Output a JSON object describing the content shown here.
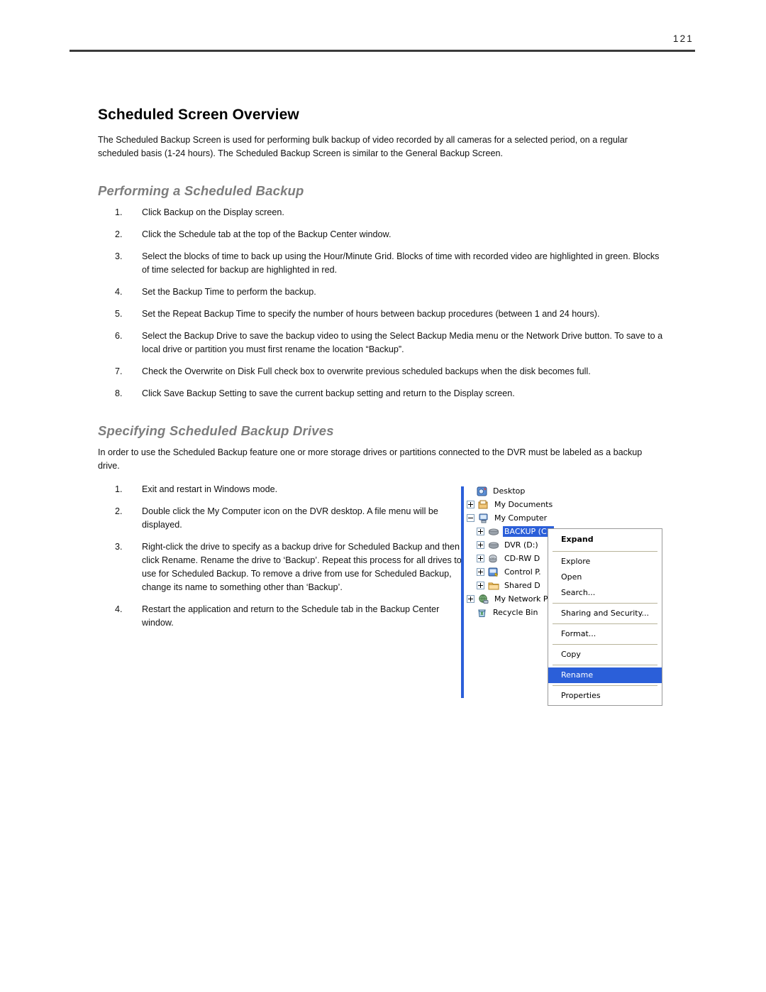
{
  "header": {
    "page_number": "121"
  },
  "main": {
    "section_title": "Scheduled Screen Overview",
    "intro": "The Scheduled Backup Screen is used for performing bulk backup of video recorded by all cameras for a selected period, on a regular scheduled basis (1-24 hours). The Scheduled Backup Screen is similar to the General Backup Screen.",
    "subsection_1": {
      "title": "Performing a Scheduled Backup",
      "steps": [
        {
          "num": "1.",
          "text": "Click Backup on the Display screen."
        },
        {
          "num": "2.",
          "text": "Click the Schedule tab at the top of the Backup Center window."
        },
        {
          "num": "3.",
          "text": "Select the blocks of time to back up using the Hour/Minute Grid. Blocks of time with recorded video are highlighted in green. Blocks of time selected for backup are highlighted in red."
        },
        {
          "num": "4.",
          "text": "Set the Backup Time to perform the backup."
        },
        {
          "num": "5.",
          "text": "Set the Repeat Backup Time to specify the number of hours between backup procedures (between 1 and 24 hours)."
        },
        {
          "num": "6.",
          "text": "Select the Backup Drive to save the backup video to using the Select Backup Media menu or the Network Drive button. To save to a local drive or partition you must first rename the location “Backup”."
        },
        {
          "num": "7.",
          "text": "Check the Overwrite on Disk Full check box to overwrite previous scheduled backups when the disk becomes full."
        },
        {
          "num": "8.",
          "text": "Click Save Backup Setting to save the current backup setting and return to the Display screen."
        }
      ]
    },
    "subsection_2": {
      "title": "Specifying Scheduled Backup Drives",
      "intro": "In order to use the Scheduled Backup feature one or more storage drives or partitions connected to the DVR must be labeled as a backup drive.",
      "steps": [
        {
          "num": "1.",
          "text": "Exit and restart in Windows mode."
        },
        {
          "num": "2.",
          "text": "Double click the My Computer icon on the DVR desktop. A file menu will be displayed."
        },
        {
          "num": "3.",
          "text": "Right-click the drive to specify as a backup drive for Scheduled Backup and then click Rename. Rename the drive to ‘Backup’. Repeat this process for all drives to use for Scheduled Backup. To remove a drive from use for Scheduled Backup, change its name to something other than ‘Backup’."
        },
        {
          "num": "4.",
          "text": "Restart the application and return to the Schedule tab in the Backup Center window."
        }
      ]
    }
  },
  "screenshot": {
    "tree": [
      {
        "label": "Desktop",
        "icon": "desktop-icon",
        "expander": "none",
        "indent": 0,
        "selected": false
      },
      {
        "label": "My Documents",
        "icon": "my-documents-icon",
        "expander": "plus",
        "indent": 0,
        "selected": false
      },
      {
        "label": "My Computer",
        "icon": "my-computer-icon",
        "expander": "minus",
        "indent": 0,
        "selected": false
      },
      {
        "label": "BACKUP (C:)",
        "icon": "hard-drive-icon",
        "expander": "plus",
        "indent": 1,
        "selected": true
      },
      {
        "label": "DVR (D:)",
        "icon": "hard-drive-icon",
        "expander": "plus",
        "indent": 1,
        "selected": false
      },
      {
        "label": "CD-RW D",
        "icon": "cd-drive-icon",
        "expander": "plus",
        "indent": 1,
        "selected": false
      },
      {
        "label": "Control P.",
        "icon": "control-panel-icon",
        "expander": "plus",
        "indent": 1,
        "selected": false
      },
      {
        "label": "Shared D",
        "icon": "folder-icon",
        "expander": "plus",
        "indent": 1,
        "selected": false
      },
      {
        "label": "My Network P",
        "icon": "network-icon",
        "expander": "plus",
        "indent": 0,
        "selected": false
      },
      {
        "label": "Recycle Bin",
        "icon": "recycle-bin-icon",
        "expander": "none",
        "indent": 0,
        "selected": false
      }
    ],
    "context_menu": [
      {
        "type": "item",
        "label": "Expand",
        "bold": true,
        "highlight": false
      },
      {
        "type": "sep"
      },
      {
        "type": "item",
        "label": "Explore",
        "bold": false,
        "highlight": false
      },
      {
        "type": "item",
        "label": "Open",
        "bold": false,
        "highlight": false
      },
      {
        "type": "item",
        "label": "Search...",
        "bold": false,
        "highlight": false
      },
      {
        "type": "sep"
      },
      {
        "type": "item",
        "label": "Sharing and Security...",
        "bold": false,
        "highlight": false
      },
      {
        "type": "sep"
      },
      {
        "type": "item",
        "label": "Format...",
        "bold": false,
        "highlight": false
      },
      {
        "type": "sep"
      },
      {
        "type": "item",
        "label": "Copy",
        "bold": false,
        "highlight": false
      },
      {
        "type": "sep"
      },
      {
        "type": "item",
        "label": "Rename",
        "bold": false,
        "highlight": true
      },
      {
        "type": "sep"
      },
      {
        "type": "item",
        "label": "Properties",
        "bold": false,
        "highlight": false
      }
    ],
    "colors": {
      "selection_blue": "#2b5fd9",
      "panel_border_blue": "#2b5fd9",
      "menu_border": "#999999",
      "menu_separator": "#b8b49a"
    }
  }
}
